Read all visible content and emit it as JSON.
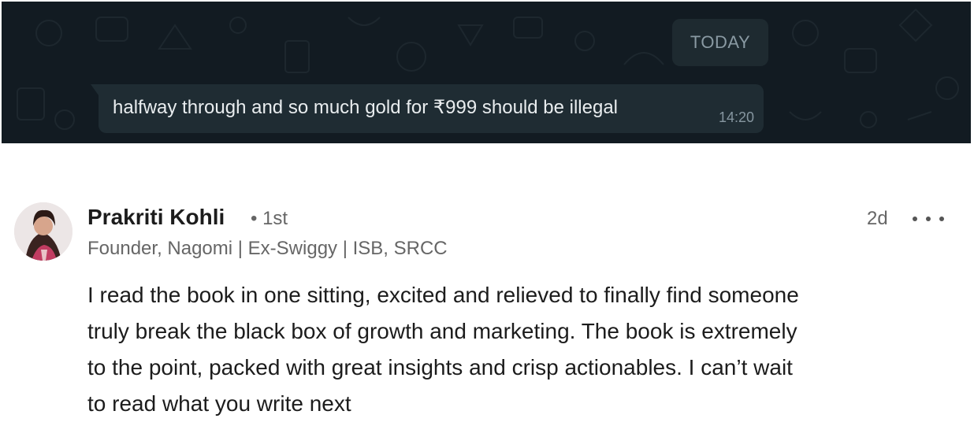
{
  "chat": {
    "day_label": "TODAY",
    "message": {
      "text": "halfway through and so much gold for ₹999 should be illegal",
      "time": "14:20"
    },
    "colors": {
      "background": "#121b22",
      "bubble": "#1f2c33",
      "pill": "#1e2a30"
    }
  },
  "post": {
    "author": {
      "name": "Prakriti Kohli",
      "connection": "• 1st",
      "headline": "Founder, Nagomi | Ex-Swiggy | ISB, SRCC"
    },
    "timestamp": "2d",
    "more_icon": "more-horizontal-icon",
    "body_lines": [
      "I read the book in one sitting, excited and relieved to finally find someone",
      "truly break the black box of growth and marketing. The book is extremely",
      "to the point, packed with great insights and crisp actionables. I can’t wait",
      "to read what you write next"
    ]
  }
}
